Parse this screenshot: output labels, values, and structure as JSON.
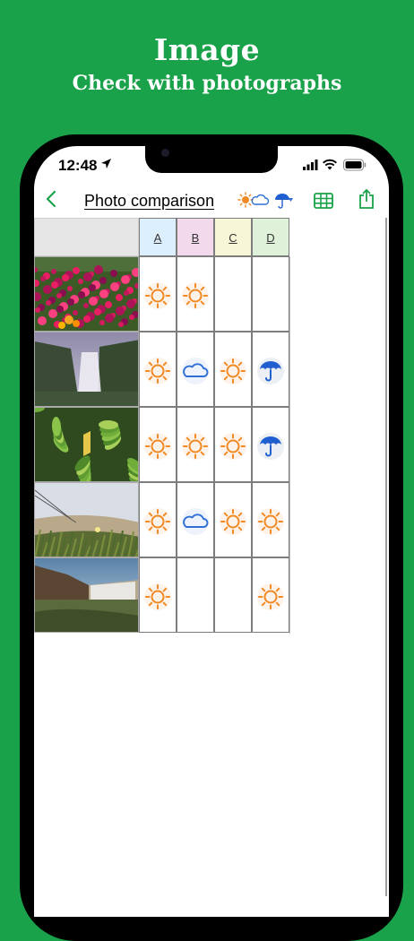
{
  "promo": {
    "title": "Image",
    "subtitle": "Check with photographs"
  },
  "status_bar": {
    "time": "12:48"
  },
  "nav": {
    "title": "Photo comparison"
  },
  "columns": [
    {
      "label": "A",
      "color": "#dbefff"
    },
    {
      "label": "B",
      "color": "#f3d9ec"
    },
    {
      "label": "C",
      "color": "#f7f6d6"
    },
    {
      "label": "D",
      "color": "#dff1d8"
    }
  ],
  "rows": [
    {
      "photo": "flowers-icon",
      "weather": [
        "sun-icon",
        "sun-icon",
        "",
        ""
      ]
    },
    {
      "photo": "waterfall-icon",
      "weather": [
        "sun-icon",
        "cloud-icon",
        "sun-icon",
        "umbrella-icon"
      ]
    },
    {
      "photo": "leaves-icon",
      "weather": [
        "sun-icon",
        "sun-icon",
        "sun-icon",
        "umbrella-icon"
      ]
    },
    {
      "photo": "grass-icon",
      "weather": [
        "sun-icon",
        "cloud-icon",
        "sun-icon",
        "sun-icon"
      ]
    },
    {
      "photo": "falls-rocks-icon",
      "weather": [
        "sun-icon",
        "",
        "",
        "sun-icon"
      ]
    }
  ],
  "colors": {
    "accent": "#1aa24a",
    "sun": "#f08a24",
    "cloud": "#2f6fd6",
    "umbrella": "#1f5fd0"
  }
}
